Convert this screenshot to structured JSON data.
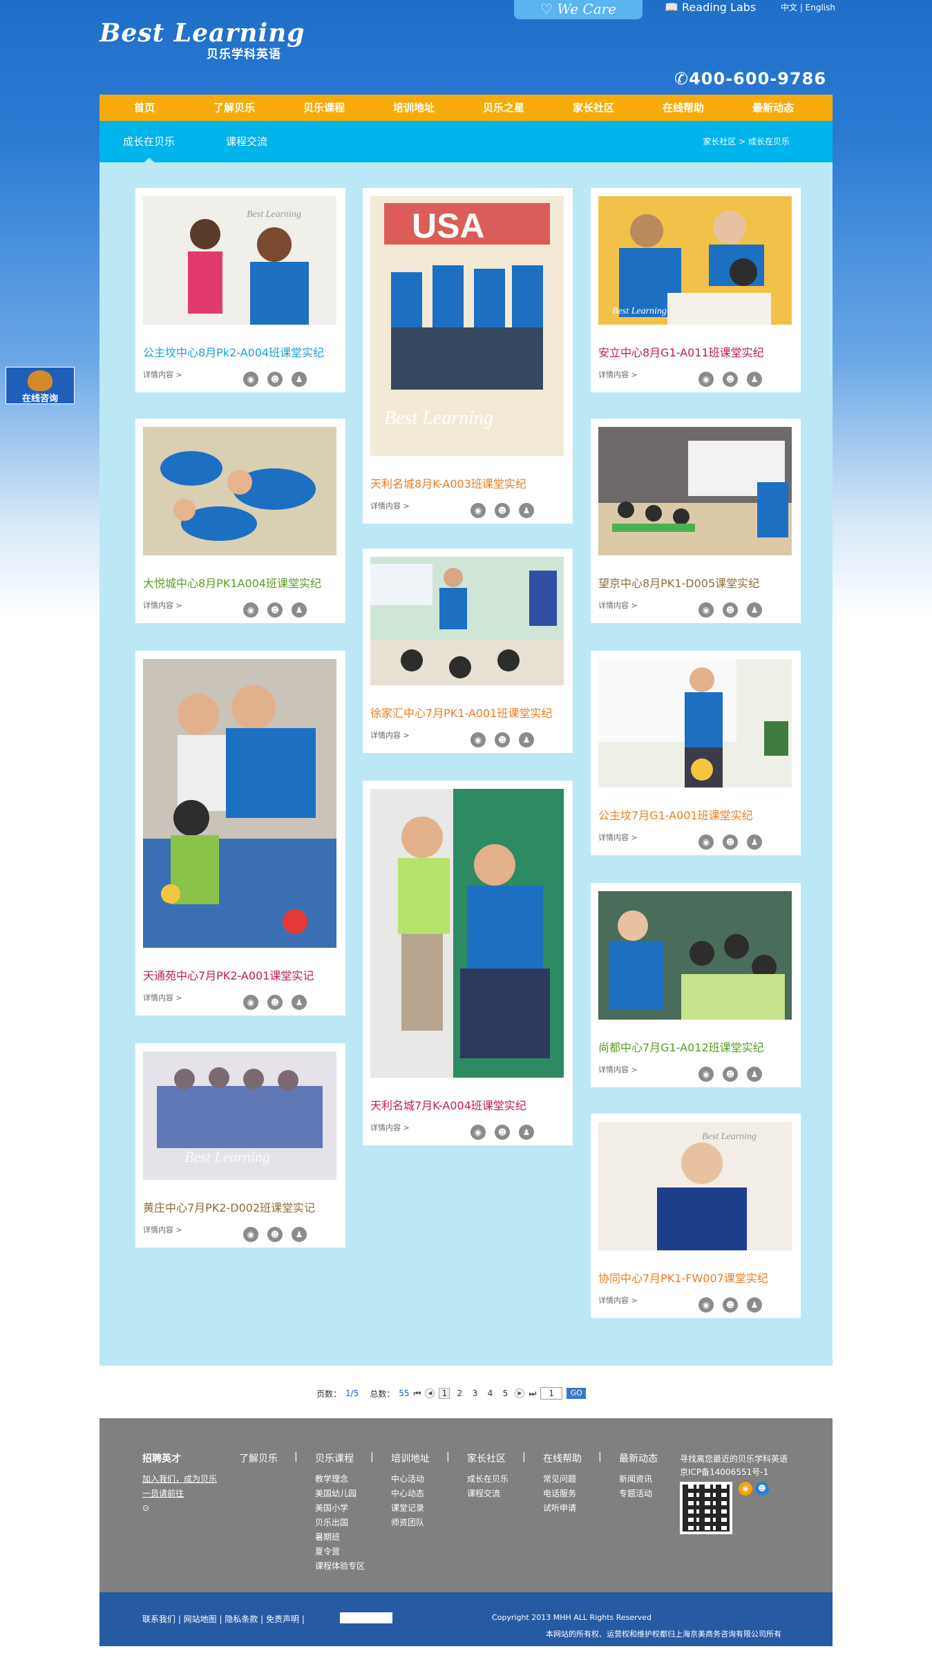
{
  "header": {
    "logo_en": "Best Learning",
    "logo_cn": "贝乐学科英语",
    "we_care": "We Care",
    "reading_labs": "Reading Labs",
    "lang": "中文 | English",
    "phone": "400-600-9786"
  },
  "nav": [
    "首页",
    "了解贝乐",
    "贝乐课程",
    "培训地址",
    "贝乐之星",
    "家长社区",
    "在线帮助",
    "最新动态"
  ],
  "subnav": {
    "tab1": "成长在贝乐",
    "tab2": "课程交流",
    "breadcrumb": "家长社区 > 成长在贝乐"
  },
  "floater": "在线咨询",
  "more_label": "详情内容 >",
  "cards": [
    {
      "title": "公主坟中心8月Pk2-A004班课堂实纪",
      "color": "#19a0d9"
    },
    {
      "title": "大悦城中心8月PK1A004班课堂实纪",
      "color": "#5b9c25"
    },
    {
      "title": "天通苑中心7月PK2-A001课堂实记",
      "color": "#c2185b"
    },
    {
      "title": "黄庄中心7月PK2-D002班课堂实记",
      "color": "#8a6d3b"
    },
    {
      "title": "天利名城8月K-A003班课堂实纪",
      "color": "#f07b1f"
    },
    {
      "title": "徐家汇中心7月PK1-A001班课堂实纪",
      "color": "#f07b1f"
    },
    {
      "title": "天利名城7月K-A004班课堂实纪",
      "color": "#c2185b"
    },
    {
      "title": "安立中心8月G1-A011班课堂实纪",
      "color": "#c2185b"
    },
    {
      "title": "望京中心8月PK1-D005课堂实纪",
      "color": "#8a6d3b"
    },
    {
      "title": "公主坟7月G1-A001班课堂实纪",
      "color": "#f07b1f"
    },
    {
      "title": "尚都中心7月G1-A012班课堂实纪",
      "color": "#5b9c25"
    },
    {
      "title": "协同中心7月PK1-FW007课堂实纪",
      "color": "#f07b1f"
    }
  ],
  "pager": {
    "pages_label": "页数：",
    "pages_val": "1/5",
    "total_label": "总数：",
    "total_val": "55",
    "nums": [
      "1",
      "2",
      "3",
      "4",
      "5"
    ],
    "input": "1",
    "go": "GO"
  },
  "footer": {
    "c1": {
      "h": "招聘英才",
      "l": [
        "加入我们，成为贝乐",
        "一员请前往",
        "⊙"
      ]
    },
    "c2": {
      "h": "了解贝乐",
      "l": []
    },
    "c3": {
      "h": "贝乐课程",
      "l": [
        "教学理念",
        "美国幼儿园",
        "美国小学",
        "贝乐出国",
        "暑期班",
        "夏令营",
        "课程体验专区"
      ]
    },
    "c4": {
      "h": "培训地址",
      "l": [
        "中心活动",
        "中心动态",
        "课堂记录",
        "师资团队"
      ]
    },
    "c5": {
      "h": "家长社区",
      "l": [
        "成长在贝乐",
        "课程交流"
      ]
    },
    "c6": {
      "h": "在线帮助",
      "l": [
        "常见问题",
        "电话服务",
        "试听申请"
      ]
    },
    "c7": {
      "h": "最新动态",
      "l": [
        "新闻资讯",
        "专题活动"
      ]
    },
    "right1": "寻找离您最近的贝乐学科英语",
    "right2": "京ICP备14006551号-1",
    "bar_links": "联系我们  |  网站地图  |  隐私条款  |  免责声明  |",
    "copyright": "Copyright 2013 MHH ALL Rights Reserved",
    "copyright2": "本网站的所有权、运营权和维护权都归上海京美商务咨询有限公司所有"
  }
}
